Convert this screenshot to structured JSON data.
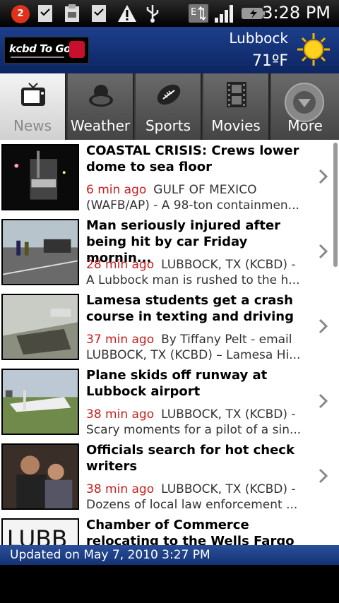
{
  "status_bar": {
    "notification_count": "2",
    "time": "3:28 PM"
  },
  "header": {
    "logo_text": "kcbd To Go",
    "city": "Lubbock",
    "temperature": "71ºF",
    "weather_icon": "sunny-icon"
  },
  "tabs": [
    {
      "label": "News",
      "icon": "tv-icon",
      "active": true
    },
    {
      "label": "Weather",
      "icon": "cloud-sun-icon",
      "active": false
    },
    {
      "label": "Sports",
      "icon": "football-icon",
      "active": false
    },
    {
      "label": "Movies",
      "icon": "film-icon",
      "active": false
    },
    {
      "label": "More",
      "icon": "chevron-down-circle-icon",
      "active": false
    }
  ],
  "articles": [
    {
      "headline": "COASTAL CRISIS: Crews lower dome to sea floor",
      "time": "6 min ago",
      "source": "GULF OF MEXICO",
      "snippet": "(WAFB/AP) - A 98-ton containmen..."
    },
    {
      "headline": "Man seriously injured after being hit by car Friday mornin...",
      "time": "28 min ago",
      "source": "LUBBOCK, TX (KCBD) -",
      "snippet": "A Lubbock man is rushed to the h..."
    },
    {
      "headline": "Lamesa students get a crash course in texting and driving",
      "time": "37 min ago",
      "source": "By Tiffany Pelt - email",
      "snippet": "LUBBOCK, TX (KCBD) – Lamesa Hi..."
    },
    {
      "headline": "Plane skids off runway at Lubbock airport",
      "time": "38 min ago",
      "source": "LUBBOCK, TX (KCBD) -",
      "snippet": "Scary moments for a pilot of a sin..."
    },
    {
      "headline": "Officials search for hot check writers",
      "time": "38 min ago",
      "source": "LUBBOCK, TX (KCBD) -",
      "snippet": "Dozens of local law enforcement ..."
    },
    {
      "headline": "Chamber of Commerce relocating to the Wells Fargo B...",
      "time": "",
      "source": "",
      "snippet": ""
    }
  ],
  "footer": {
    "updated_text": "Updated on May 7, 2010 3:27 PM"
  },
  "colors": {
    "header_blue": "#1c3f8c",
    "time_red": "#c81d1d",
    "footer_blue": "#2a4f9a"
  }
}
